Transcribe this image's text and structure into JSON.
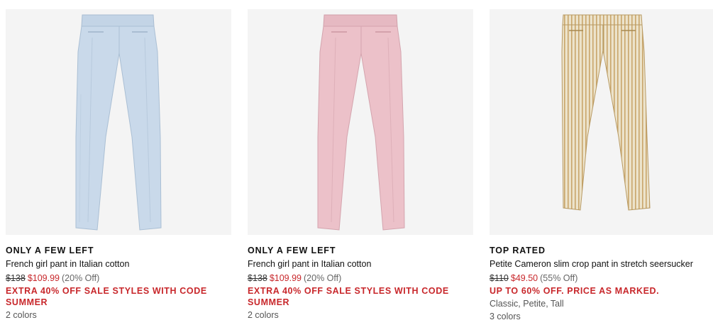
{
  "products": [
    {
      "badge": "ONLY A FEW LEFT",
      "name": "French girl pant in Italian cotton",
      "price_original": "$138",
      "price_sale": "$109.99",
      "price_off": "(20% Off)",
      "promo": "EXTRA 40% OFF SALE STYLES WITH CODE SUMMER",
      "sub": "",
      "colors": "2 colors",
      "image": {
        "icon": "pant-light-blue-image",
        "color": "#c9d9ea",
        "shade": "#b3c6da"
      }
    },
    {
      "badge": "ONLY A FEW LEFT",
      "name": "French girl pant in Italian cotton",
      "price_original": "$138",
      "price_sale": "$109.99",
      "price_off": "(20% Off)",
      "promo": "EXTRA 40% OFF SALE STYLES WITH CODE SUMMER",
      "sub": "",
      "colors": "2 colors",
      "image": {
        "icon": "pant-pink-image",
        "color": "#ecc1c9",
        "shade": "#dcaab4"
      }
    },
    {
      "badge": "TOP RATED",
      "name": "Petite Cameron slim crop pant in stretch seersucker",
      "price_original": "$110",
      "price_sale": "$49.50",
      "price_off": "(55% Off)",
      "promo": "UP TO 60% OFF. PRICE AS MARKED.",
      "sub": "Classic, Petite, Tall",
      "colors": "3 colors",
      "image": {
        "icon": "pant-seersucker-image",
        "color": "#eadfc4",
        "shade": "#c9a66b"
      }
    }
  ],
  "colors": {
    "sale_red": "#c8272b",
    "image_bg": "#f4f4f4"
  }
}
